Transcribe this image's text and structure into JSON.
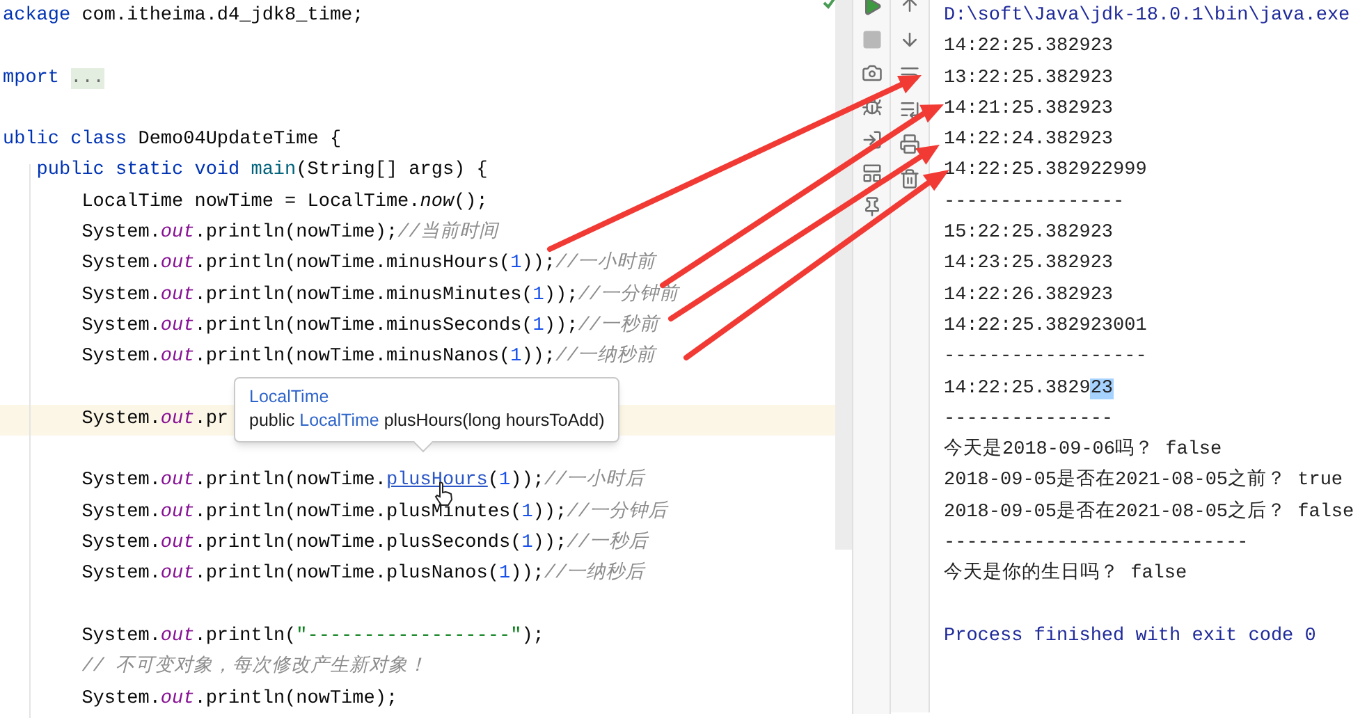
{
  "editor": {
    "lines": [
      {
        "kind": "code",
        "current": false,
        "tokens": [
          {
            "kind": "keyword",
            "text": "ackage"
          },
          {
            "kind": "plain",
            "text": " com.itheima.d4_jdk8_time;"
          }
        ]
      },
      {
        "kind": "blank",
        "current": false
      },
      {
        "kind": "code",
        "current": false,
        "tokens": [
          {
            "kind": "keyword",
            "text": "mport "
          },
          {
            "kind": "fold",
            "text": "..."
          }
        ]
      },
      {
        "kind": "blank",
        "current": false
      },
      {
        "kind": "code",
        "current": false,
        "tokens": [
          {
            "kind": "keyword",
            "text": "ublic class"
          },
          {
            "kind": "plain",
            "text": " Demo04UpdateTime {"
          }
        ]
      },
      {
        "kind": "code",
        "current": false,
        "tokens": [
          {
            "kind": "keyword",
            "text": "   public static void "
          },
          {
            "kind": "method",
            "text": "main"
          },
          {
            "kind": "plain",
            "text": "(String[] args) {"
          }
        ]
      },
      {
        "kind": "code",
        "current": false,
        "tokens": [
          {
            "kind": "plain",
            "text": "       LocalTime nowTime = LocalTime."
          },
          {
            "kind": "static",
            "text": "now"
          },
          {
            "kind": "plain",
            "text": "();"
          }
        ]
      },
      {
        "kind": "code",
        "current": false,
        "tokens": [
          {
            "kind": "plain",
            "text": "       System."
          },
          {
            "kind": "field",
            "text": "out"
          },
          {
            "kind": "plain",
            "text": ".println(nowTime);"
          },
          {
            "kind": "comment",
            "text": "//当前时间"
          }
        ]
      },
      {
        "kind": "code",
        "current": false,
        "tokens": [
          {
            "kind": "plain",
            "text": "       System."
          },
          {
            "kind": "field",
            "text": "out"
          },
          {
            "kind": "plain",
            "text": ".println(nowTime.minusHours("
          },
          {
            "kind": "number",
            "text": "1"
          },
          {
            "kind": "plain",
            "text": "));"
          },
          {
            "kind": "comment",
            "text": "//一小时前"
          }
        ]
      },
      {
        "kind": "code",
        "current": false,
        "tokens": [
          {
            "kind": "plain",
            "text": "       System."
          },
          {
            "kind": "field",
            "text": "out"
          },
          {
            "kind": "plain",
            "text": ".println(nowTime.minusMinutes("
          },
          {
            "kind": "number",
            "text": "1"
          },
          {
            "kind": "plain",
            "text": "));"
          },
          {
            "kind": "comment",
            "text": "//一分钟前"
          }
        ]
      },
      {
        "kind": "code",
        "current": false,
        "tokens": [
          {
            "kind": "plain",
            "text": "       System."
          },
          {
            "kind": "field",
            "text": "out"
          },
          {
            "kind": "plain",
            "text": ".println(nowTime.minusSeconds("
          },
          {
            "kind": "number",
            "text": "1"
          },
          {
            "kind": "plain",
            "text": "));"
          },
          {
            "kind": "comment",
            "text": "//一秒前"
          }
        ]
      },
      {
        "kind": "code",
        "current": false,
        "tokens": [
          {
            "kind": "plain",
            "text": "       System."
          },
          {
            "kind": "field",
            "text": "out"
          },
          {
            "kind": "plain",
            "text": ".println(nowTime.minusNanos("
          },
          {
            "kind": "number",
            "text": "1"
          },
          {
            "kind": "plain",
            "text": "));"
          },
          {
            "kind": "comment",
            "text": "//一纳秒前"
          }
        ]
      },
      {
        "kind": "blank",
        "current": false
      },
      {
        "kind": "code",
        "current": true,
        "tokens": [
          {
            "kind": "plain",
            "text": "       System."
          },
          {
            "kind": "field",
            "text": "out"
          },
          {
            "kind": "plain",
            "text": ".pr"
          }
        ]
      },
      {
        "kind": "blank",
        "current": false
      },
      {
        "kind": "code",
        "current": false,
        "tokens": [
          {
            "kind": "plain",
            "text": "       System."
          },
          {
            "kind": "field",
            "text": "out"
          },
          {
            "kind": "plain",
            "text": ".println(nowTime."
          },
          {
            "kind": "link",
            "text": "plusHours"
          },
          {
            "kind": "plain",
            "text": "("
          },
          {
            "kind": "number",
            "text": "1"
          },
          {
            "kind": "plain",
            "text": "));"
          },
          {
            "kind": "comment",
            "text": "//一小时后"
          }
        ]
      },
      {
        "kind": "code",
        "current": false,
        "tokens": [
          {
            "kind": "plain",
            "text": "       System."
          },
          {
            "kind": "field",
            "text": "out"
          },
          {
            "kind": "plain",
            "text": ".println(nowTime.plusMinutes("
          },
          {
            "kind": "number",
            "text": "1"
          },
          {
            "kind": "plain",
            "text": "));"
          },
          {
            "kind": "comment",
            "text": "//一分钟后"
          }
        ]
      },
      {
        "kind": "code",
        "current": false,
        "tokens": [
          {
            "kind": "plain",
            "text": "       System."
          },
          {
            "kind": "field",
            "text": "out"
          },
          {
            "kind": "plain",
            "text": ".println(nowTime.plusSeconds("
          },
          {
            "kind": "number",
            "text": "1"
          },
          {
            "kind": "plain",
            "text": "));"
          },
          {
            "kind": "comment",
            "text": "//一秒后"
          }
        ]
      },
      {
        "kind": "code",
        "current": false,
        "tokens": [
          {
            "kind": "plain",
            "text": "       System."
          },
          {
            "kind": "field",
            "text": "out"
          },
          {
            "kind": "plain",
            "text": ".println(nowTime.plusNanos("
          },
          {
            "kind": "number",
            "text": "1"
          },
          {
            "kind": "plain",
            "text": "));"
          },
          {
            "kind": "comment",
            "text": "//一纳秒后"
          }
        ]
      },
      {
        "kind": "blank",
        "current": false
      },
      {
        "kind": "code",
        "current": false,
        "tokens": [
          {
            "kind": "plain",
            "text": "       System."
          },
          {
            "kind": "field",
            "text": "out"
          },
          {
            "kind": "plain",
            "text": ".println("
          },
          {
            "kind": "string",
            "text": "\"------------------\""
          },
          {
            "kind": "plain",
            "text": ");"
          }
        ]
      },
      {
        "kind": "code",
        "current": false,
        "tokens": [
          {
            "kind": "comment",
            "text": "       // 不可变对象，每次修改产生新对象！"
          }
        ]
      },
      {
        "kind": "code",
        "current": false,
        "tokens": [
          {
            "kind": "plain",
            "text": "       System."
          },
          {
            "kind": "field",
            "text": "out"
          },
          {
            "kind": "plain",
            "text": ".println(nowTime);"
          }
        ]
      }
    ],
    "tooltip": {
      "title": "LocalTime",
      "signature": [
        {
          "kind": "plain",
          "text": "public "
        },
        {
          "kind": "type",
          "text": "LocalTime"
        },
        {
          "kind": "plain",
          "text": " plusHours(long hoursToAdd)"
        }
      ]
    }
  },
  "console": {
    "lines": [
      {
        "kind": "system",
        "text": "D:\\soft\\Java\\jdk-18.0.1\\bin\\java.exe"
      },
      {
        "kind": "output",
        "text": "14:22:25.382923"
      },
      {
        "kind": "output",
        "text": "13:22:25.382923"
      },
      {
        "kind": "output",
        "text": "14:21:25.382923"
      },
      {
        "kind": "output",
        "text": "14:22:24.382923"
      },
      {
        "kind": "output",
        "text": "14:22:25.382922999"
      },
      {
        "kind": "output",
        "text": "----------------"
      },
      {
        "kind": "output",
        "text": "15:22:25.382923"
      },
      {
        "kind": "output",
        "text": "14:23:25.382923"
      },
      {
        "kind": "output",
        "text": "14:22:26.382923"
      },
      {
        "kind": "output",
        "text": "14:22:25.382923001"
      },
      {
        "kind": "output",
        "text": "------------------"
      },
      {
        "kind": "output",
        "parts": [
          {
            "text": "14:22:25.3829",
            "selected": false
          },
          {
            "text": "23",
            "selected": true
          }
        ]
      },
      {
        "kind": "output",
        "text": "---------------"
      },
      {
        "kind": "output",
        "text": "今天是2018-09-06吗？ false"
      },
      {
        "kind": "output",
        "text": "2018-09-05是否在2021-08-05之前？ true"
      },
      {
        "kind": "output",
        "text": "2018-09-05是否在2021-08-05之后？ false"
      },
      {
        "kind": "output",
        "text": "---------------------------"
      },
      {
        "kind": "output",
        "text": "今天是你的生日吗？ false"
      },
      {
        "kind": "blank"
      },
      {
        "kind": "system",
        "text": "Process finished with exit code 0"
      }
    ]
  }
}
